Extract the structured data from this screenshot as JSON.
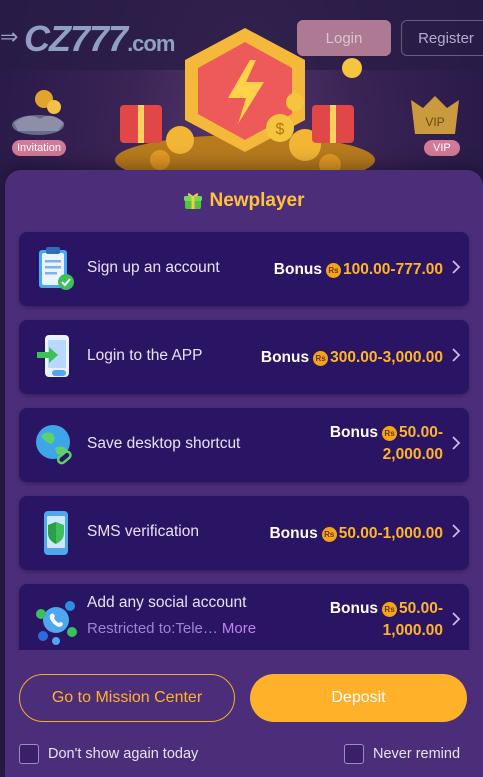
{
  "header": {
    "logo_main": "CZ777",
    "logo_suffix": ".com",
    "login_label": "Login",
    "register_label": "Register",
    "invitation_label": "Invitation",
    "vip_label": "VIP",
    "vip_badge_text": "VIP"
  },
  "modal": {
    "title": "Newplayer",
    "currency_symbol": "Rs",
    "missions": [
      {
        "icon": "clipboard-check-icon",
        "title": "Sign up an account",
        "bonus_label": "Bonus",
        "amount": "100.00-777.00"
      },
      {
        "icon": "phone-login-icon",
        "title": "Login to the APP",
        "bonus_label": "Bonus",
        "amount": "300.00-3,000.00"
      },
      {
        "icon": "globe-link-icon",
        "title": "Save desktop shortcut",
        "bonus_label": "Bonus",
        "amount_line1": "50.00-",
        "amount_line2": "2,000.00"
      },
      {
        "icon": "shield-phone-icon",
        "title": "SMS verification",
        "bonus_label": "Bonus",
        "amount": "50.00-1,000.00"
      },
      {
        "icon": "social-network-icon",
        "title": "Add any social account",
        "subtitle": "Restricted to:Tele…",
        "more_label": "More",
        "bonus_label": "Bonus",
        "amount_line1": "50.00-",
        "amount_line2": "1,000.00"
      }
    ],
    "go_mission_label": "Go to Mission Center",
    "deposit_label": "Deposit",
    "dont_show_label": "Don't show again today",
    "never_remind_label": "Never remind"
  },
  "colors": {
    "accent_gold": "#ffb42b",
    "modal_bg": "#4b2d7a",
    "card_bg": "#2a1565"
  }
}
